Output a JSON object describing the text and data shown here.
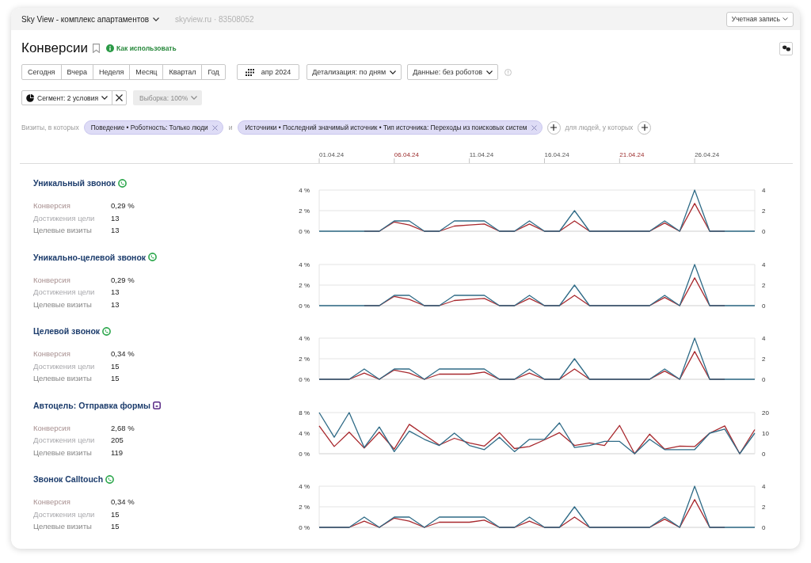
{
  "header": {
    "counter_name": "Sky View - комплекс апартаментов",
    "site": "skyview.ru · 83508052",
    "account_button": "Учетная запись"
  },
  "title": "Конверсии",
  "help_link": "Как использовать",
  "periods": [
    {
      "label": "Сегодня",
      "selected": false
    },
    {
      "label": "Вчера",
      "selected": false
    },
    {
      "label": "Неделя",
      "selected": false
    },
    {
      "label": "Месяц",
      "selected": false
    },
    {
      "label": "Квартал",
      "selected": false
    },
    {
      "label": "Год",
      "selected": false
    }
  ],
  "date_range": "апр 2024",
  "detail_dropdown": "Детализация: по дням",
  "data_dropdown": "Данные: без роботов",
  "segment": {
    "button": "Сегмент: 2 условия",
    "sample": "Выборка: 100%"
  },
  "filters": {
    "visits_label": "Визиты, в которых",
    "joiner": "и",
    "conditions": [
      "Поведение • Роботность: Только люди",
      "Источники • Последний значимый источник • Тип источника: Переходы из поисковых систем"
    ],
    "people_label": "для людей, у которых"
  },
  "date_axis": {
    "ticks": [
      {
        "label": "01.04.24",
        "weekend": false
      },
      {
        "label": "06.04.24",
        "weekend": true
      },
      {
        "label": "11.04.24",
        "weekend": false
      },
      {
        "label": "16.04.24",
        "weekend": false
      },
      {
        "label": "21.04.24",
        "weekend": true
      },
      {
        "label": "26.04.24",
        "weekend": false
      }
    ]
  },
  "goals": [
    {
      "title": "Уникальный звонок",
      "kind": "call",
      "metrics": [
        {
          "label": "Конверсия",
          "value": "0,29 %"
        },
        {
          "label": "Достижения цели",
          "value": "13"
        },
        {
          "label": "Целевые визиты",
          "value": "13"
        }
      ],
      "chart_data": {
        "type": "line",
        "ylim": [
          0,
          4
        ],
        "yticks": [
          {
            "value": 0,
            "label": "0 %"
          },
          {
            "value": 2,
            "label": "2 %"
          },
          {
            "value": 4,
            "label": "4 %"
          }
        ],
        "y2lim": [
          0,
          4
        ],
        "y2ticks": [
          {
            "value": 0,
            "label": "0"
          },
          {
            "value": 2,
            "label": "2"
          },
          {
            "value": 4,
            "label": "4"
          }
        ],
        "series": [
          {
            "color": "#a8282d",
            "values": [
              null,
              null,
              null,
              0,
              0,
              0.9,
              0.6,
              0,
              0,
              0.5,
              0.6,
              0.7,
              0,
              0,
              0.7,
              0,
              0,
              1.0,
              0,
              0,
              0,
              0,
              0,
              0.8,
              0,
              2.7,
              0,
              0,
              null,
              null
            ]
          },
          {
            "color": "#2f6b87",
            "axis": "y2",
            "values": [
              0,
              0,
              0,
              0,
              0,
              1,
              1,
              0,
              0,
              1,
              1,
              1,
              0,
              0,
              1,
              0,
              0,
              2,
              0,
              0,
              0,
              0,
              0,
              1,
              0,
              4,
              0,
              0,
              0,
              0
            ]
          }
        ]
      }
    },
    {
      "title": "Уникально-целевой звонок",
      "kind": "call",
      "metrics": [
        {
          "label": "Конверсия",
          "value": "0,29 %"
        },
        {
          "label": "Достижения цели",
          "value": "13"
        },
        {
          "label": "Целевые визиты",
          "value": "13"
        }
      ],
      "chart_data": {
        "type": "line",
        "ylim": [
          0,
          4
        ],
        "yticks": [
          {
            "value": 0,
            "label": "0 %"
          },
          {
            "value": 2,
            "label": "2 %"
          },
          {
            "value": 4,
            "label": "4 %"
          }
        ],
        "y2lim": [
          0,
          4
        ],
        "y2ticks": [
          {
            "value": 0,
            "label": "0"
          },
          {
            "value": 2,
            "label": "2"
          },
          {
            "value": 4,
            "label": "4"
          }
        ],
        "series": [
          {
            "color": "#a8282d",
            "values": [
              null,
              null,
              null,
              0,
              0,
              0.9,
              0.6,
              0,
              0,
              0.5,
              0.6,
              0.7,
              0,
              0,
              0.7,
              0,
              0,
              1.0,
              0,
              0,
              0,
              0,
              0,
              0.8,
              0,
              2.7,
              0,
              0,
              null,
              null
            ]
          },
          {
            "color": "#2f6b87",
            "axis": "y2",
            "values": [
              0,
              0,
              0,
              0,
              0,
              1,
              1,
              0,
              0,
              1,
              1,
              1,
              0,
              0,
              1,
              0,
              0,
              2,
              0,
              0,
              0,
              0,
              0,
              1,
              0,
              4,
              0,
              0,
              0,
              0
            ]
          }
        ]
      }
    },
    {
      "title": "Целевой звонок",
      "kind": "call",
      "metrics": [
        {
          "label": "Конверсия",
          "value": "0,34 %"
        },
        {
          "label": "Достижения цели",
          "value": "15"
        },
        {
          "label": "Целевые визиты",
          "value": "15"
        }
      ],
      "chart_data": {
        "type": "line",
        "ylim": [
          0,
          4
        ],
        "yticks": [
          {
            "value": 0,
            "label": "0 %"
          },
          {
            "value": 2,
            "label": "2 %"
          },
          {
            "value": 4,
            "label": "4 %"
          }
        ],
        "y2lim": [
          0,
          4
        ],
        "y2ticks": [
          {
            "value": 0,
            "label": "0"
          },
          {
            "value": 2,
            "label": "2"
          },
          {
            "value": 4,
            "label": "4"
          }
        ],
        "series": [
          {
            "color": "#a8282d",
            "values": [
              0,
              0,
              0,
              0.6,
              0,
              0.9,
              0.6,
              0,
              0.5,
              0.5,
              0.5,
              0.7,
              0,
              0,
              0.6,
              0,
              0,
              1.0,
              0,
              0,
              0,
              0,
              0,
              0.8,
              0,
              2.7,
              0,
              0,
              null,
              null
            ]
          },
          {
            "color": "#2f6b87",
            "axis": "y2",
            "values": [
              0,
              0,
              0,
              1,
              0,
              1,
              1,
              0,
              1,
              1,
              1,
              1,
              0,
              0,
              1,
              0,
              0,
              2,
              0,
              0,
              0,
              0,
              0,
              1,
              0,
              4,
              0,
              0,
              0,
              0
            ]
          }
        ]
      }
    },
    {
      "title": "Автоцель: Отправка формы",
      "kind": "form",
      "metrics": [
        {
          "label": "Конверсия",
          "value": "2,68 %"
        },
        {
          "label": "Достижения цели",
          "value": "205"
        },
        {
          "label": "Целевые визиты",
          "value": "119"
        }
      ],
      "chart_data": {
        "type": "line",
        "ylim": [
          0,
          8
        ],
        "yticks": [
          {
            "value": 0,
            "label": "0 %"
          },
          {
            "value": 4,
            "label": "4 %"
          },
          {
            "value": 8,
            "label": "8 %"
          }
        ],
        "y2lim": [
          0,
          20
        ],
        "y2ticks": [
          {
            "value": 0,
            "label": "0"
          },
          {
            "value": 10,
            "label": "10"
          },
          {
            "value": 20,
            "label": "20"
          }
        ],
        "series": [
          {
            "color": "#a8282d",
            "values": [
              5.4,
              1.4,
              4.2,
              1.1,
              4.2,
              0.9,
              5.7,
              3.7,
              1.7,
              3.0,
              2.1,
              1.5,
              4.1,
              1.0,
              1.4,
              2.7,
              4.1,
              1.6,
              2.1,
              1.6,
              5.5,
              0,
              3.8,
              0.9,
              1.5,
              1.4,
              4.0,
              5.4,
              0,
              4.7
            ]
          },
          {
            "color": "#2f6b87",
            "axis": "y2",
            "values": [
              20,
              8,
              20,
              3,
              13,
              1,
              11,
              7,
              4,
              10,
              4,
              2,
              8,
              1,
              7,
              7,
              15,
              3,
              4,
              6,
              6,
              0,
              7,
              2,
              2,
              2,
              10,
              12,
              0,
              10
            ]
          }
        ]
      }
    },
    {
      "title": "Звонок Calltouch",
      "kind": "call",
      "metrics": [
        {
          "label": "Конверсия",
          "value": "0,34 %"
        },
        {
          "label": "Достижения цели",
          "value": "15"
        },
        {
          "label": "Целевые визиты",
          "value": "15"
        }
      ],
      "chart_data": {
        "type": "line",
        "ylim": [
          0,
          4
        ],
        "yticks": [
          {
            "value": 0,
            "label": "0 %"
          },
          {
            "value": 2,
            "label": "2 %"
          },
          {
            "value": 4,
            "label": "4 %"
          }
        ],
        "y2lim": [
          0,
          4
        ],
        "y2ticks": [
          {
            "value": 0,
            "label": "0"
          },
          {
            "value": 2,
            "label": "2"
          },
          {
            "value": 4,
            "label": "4"
          }
        ],
        "series": [
          {
            "color": "#a8282d",
            "values": [
              0,
              0,
              0,
              0.6,
              0,
              0.9,
              0.6,
              0,
              0.5,
              0.5,
              0.5,
              0.7,
              0,
              0,
              0.6,
              0,
              0,
              1.0,
              0,
              0,
              0,
              0,
              0,
              0.8,
              0,
              2.7,
              0,
              0,
              null,
              null
            ]
          },
          {
            "color": "#2f6b87",
            "axis": "y2",
            "values": [
              0,
              0,
              0,
              1,
              0,
              1,
              1,
              0,
              1,
              1,
              1,
              1,
              0,
              0,
              1,
              0,
              0,
              2,
              0,
              0,
              0,
              0,
              0,
              1,
              0,
              4,
              0,
              0,
              0,
              0
            ]
          }
        ]
      }
    }
  ]
}
